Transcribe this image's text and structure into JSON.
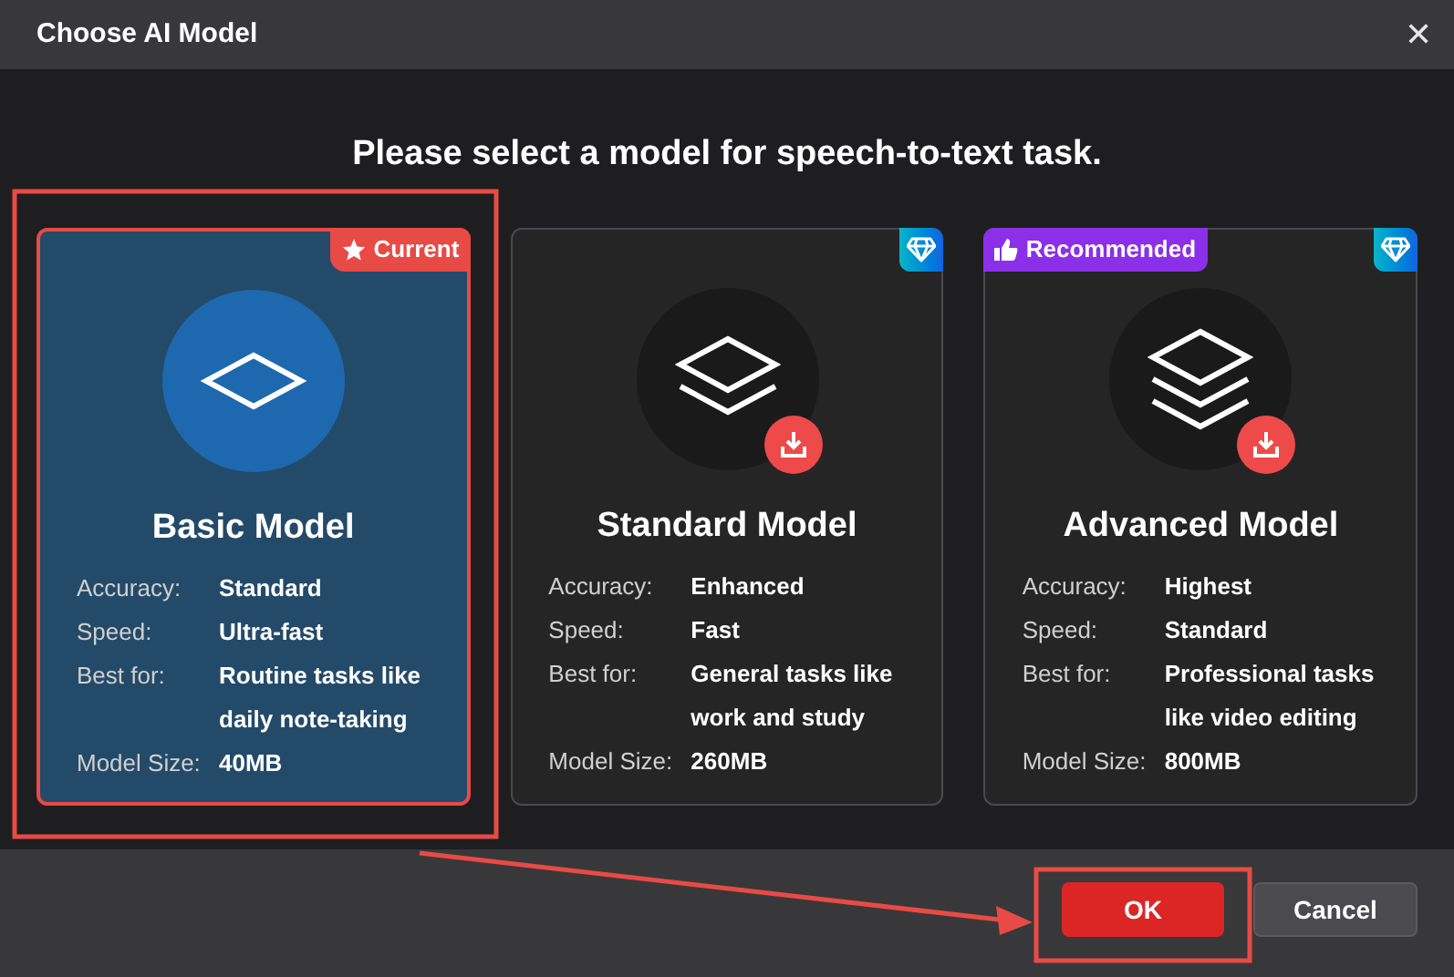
{
  "window": {
    "title": "Choose AI Model",
    "close": "✕"
  },
  "heading": "Please select a model for speech-to-text task.",
  "models": [
    {
      "name": "Basic Model",
      "kind": "single",
      "selected": true,
      "badge": {
        "kind": "current",
        "text": "Current"
      },
      "premium": false,
      "downloadable": false,
      "specs": [
        {
          "label": "Accuracy:",
          "value": "Standard"
        },
        {
          "label": "Speed:",
          "value": "Ultra-fast"
        },
        {
          "label": "Best for:",
          "value": "Routine tasks like daily note-taking"
        },
        {
          "label": "Model Size:",
          "value": "40MB"
        }
      ]
    },
    {
      "name": "Standard Model",
      "kind": "double",
      "selected": false,
      "premium": true,
      "downloadable": true,
      "specs": [
        {
          "label": "Accuracy:",
          "value": "Enhanced"
        },
        {
          "label": "Speed:",
          "value": "Fast"
        },
        {
          "label": "Best for:",
          "value": "General tasks like work and study"
        },
        {
          "label": "Model Size:",
          "value": "260MB"
        }
      ]
    },
    {
      "name": "Advanced Model",
      "kind": "triple",
      "selected": false,
      "badge": {
        "kind": "recommended",
        "text": "Recommended"
      },
      "premium": true,
      "downloadable": true,
      "specs": [
        {
          "label": "Accuracy:",
          "value": "Highest"
        },
        {
          "label": "Speed:",
          "value": "Standard"
        },
        {
          "label": "Best for:",
          "value": "Professional tasks like video editing"
        },
        {
          "label": "Model Size:",
          "value": "800MB"
        }
      ]
    }
  ],
  "buttons": [
    {
      "kind": "primary",
      "label": "OK"
    },
    {
      "kind": "secondary",
      "label": "Cancel"
    }
  ]
}
